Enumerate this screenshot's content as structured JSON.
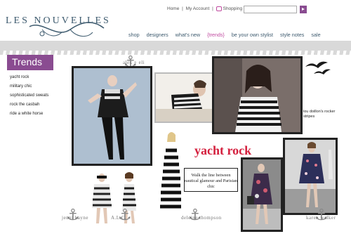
{
  "brand": {
    "name": "LES NOUVELLES"
  },
  "toplinks": {
    "home": "Home",
    "sep": "|",
    "account": "My Account",
    "sep2": "|",
    "bag": "Shopping Bag (0)"
  },
  "search": {
    "value": "",
    "placeholder": ""
  },
  "nav": [
    "shop",
    "designers",
    "what's new",
    "{trends}",
    "be your own stylist",
    "style notes",
    "sale"
  ],
  "sidebar": {
    "title": "Trends",
    "items": [
      "yacht rock",
      "military chic",
      "sophisticated sweats",
      "rock the casbah",
      "ride a white horse"
    ]
  },
  "signatures": {
    "top": "alex + eli",
    "jk": "jenni kayne",
    "alc": "A.L.C.",
    "dt": "deleine thompson",
    "kw": "karen walker"
  },
  "headline": "yacht rock",
  "caption": "Walk the line between nautical glamour and Parisian chic",
  "lou_caption": "lou doillon's rocker stripes",
  "colors": {
    "accent": "#8a4c91",
    "nav_active": "#c04aa0",
    "headline": "#d4203e",
    "logo": "#3d5a6e"
  }
}
